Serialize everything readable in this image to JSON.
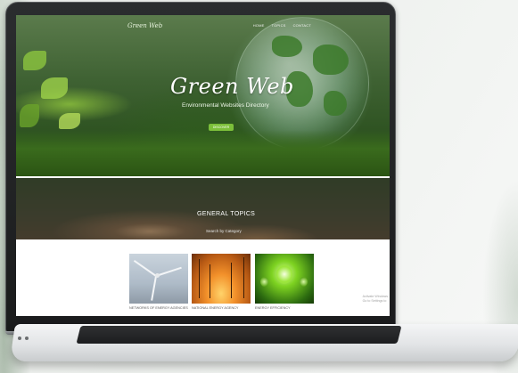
{
  "website": {
    "brand": "Green Web",
    "nav": [
      "HOME",
      "TOPICS",
      "CONTACT"
    ],
    "hero": {
      "title": "Green Web",
      "subtitle": "Environmental Websites Directory",
      "button_label": "DISCOVER"
    },
    "topics": {
      "title": "GENERAL TOPICS",
      "subtitle": "Search by Category"
    },
    "cards": [
      {
        "label": "NETWORKS OF ENERGY AGENCIES",
        "image": "wind-turbine"
      },
      {
        "label": "NATIONAL ENERGY AGENCY",
        "image": "power-lines-sunset"
      },
      {
        "label": "ENERGY EFFICIENCY",
        "image": "green-light-bulbs"
      }
    ],
    "watermark": {
      "line1": "Activate Windows",
      "line2": "Go to Settings to"
    }
  },
  "colors": {
    "accent": "#7cbf3a",
    "hero_dark": "#2d5220",
    "laptop_frame": "#1f2022"
  }
}
